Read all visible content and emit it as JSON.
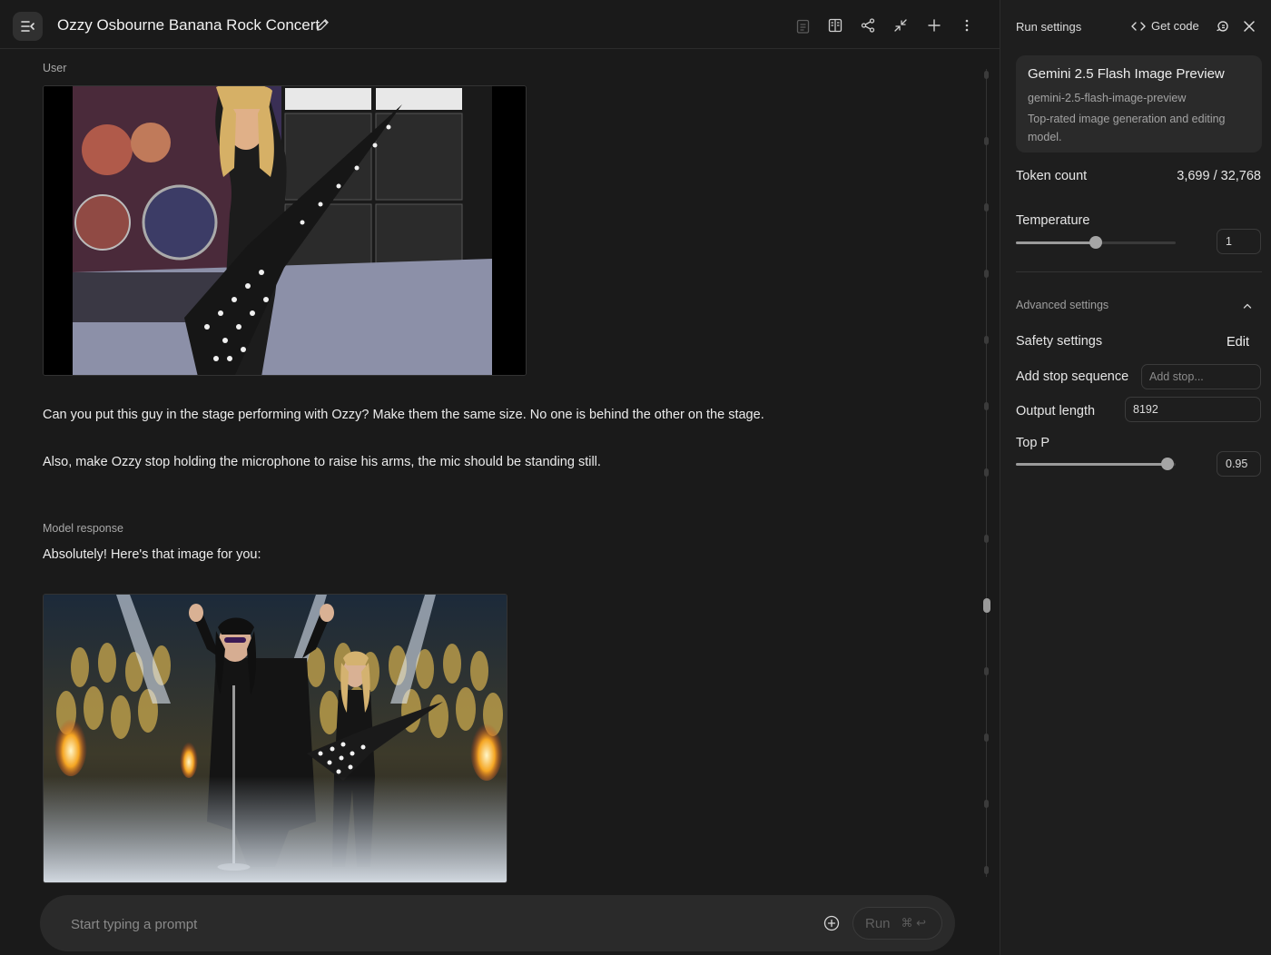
{
  "header": {
    "title": "Ozzy Osbourne Banana Rock Concert",
    "icons": [
      "menu-collapse-icon",
      "edit-pencil-icon",
      "clipboard-icon",
      "compare-icon",
      "share-icon",
      "compress-icon",
      "plus-icon",
      "more-vertical-icon"
    ]
  },
  "chat": {
    "user_label": "User",
    "user_message_1": "Can you put this guy in the stage performing with Ozzy? Make them the same size. No one is behind the other on the stage.",
    "user_message_2": "Also, make Ozzy stop holding the microphone to raise his arms, the mic should be standing still.",
    "model_label": "Model response",
    "model_message": "Absolutely! Here's that image for you:"
  },
  "prompt": {
    "placeholder": "Start typing a prompt",
    "run_label": "Run",
    "run_shortcut": "⌘ ↩"
  },
  "panel": {
    "title": "Run settings",
    "get_code_label": "Get code",
    "model": {
      "name": "Gemini 2.5 Flash Image Preview",
      "id": "gemini-2.5-flash-image-preview",
      "description": "Top-rated image generation and editing model."
    },
    "token_count_label": "Token count",
    "token_count_value": "3,699 / 32,768",
    "temperature_label": "Temperature",
    "temperature_value": "1",
    "temperature_fraction": 0.5,
    "advanced_label": "Advanced settings",
    "safety_label": "Safety settings",
    "safety_edit_label": "Edit",
    "stop_sequence_label": "Add stop sequence",
    "stop_sequence_placeholder": "Add stop...",
    "output_length_label": "Output length",
    "output_length_value": "8192",
    "top_p_label": "Top P",
    "top_p_value": "0.95",
    "top_p_fraction": 0.95
  },
  "colors": {
    "background": "#1a1a1a",
    "panel": "#1e1e1e",
    "card": "#2a2a2a",
    "text": "#e3e3e3",
    "muted": "#a3a3a3"
  }
}
